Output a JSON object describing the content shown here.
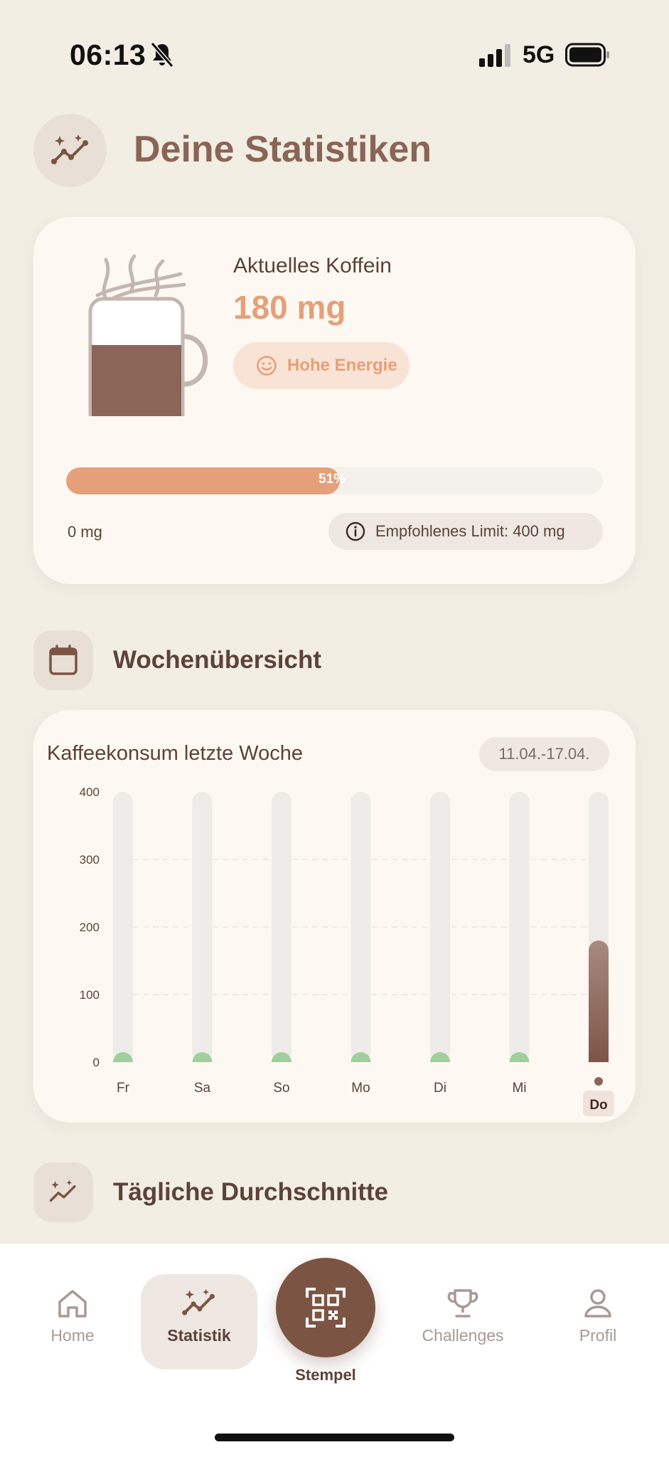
{
  "status_bar": {
    "time": "06:13",
    "network": "5G"
  },
  "header": {
    "title": "Deine Statistiken",
    "icon": "stats-sparkle-icon"
  },
  "caffeine": {
    "label": "Aktuelles Koffein",
    "value": "180 mg",
    "energy_label": "Hohe Energie",
    "energy_icon": "smile-icon",
    "progress_percent": 51,
    "progress_text": "51%",
    "min_label": "0 mg",
    "limit_label": "Empfohlenes Limit: 400 mg",
    "limit_icon": "info-icon",
    "accent_color": "#e5a07a"
  },
  "week_section": {
    "title": "Wochenübersicht",
    "icon": "calendar-icon"
  },
  "week_chart": {
    "title": "Kaffeekonsum letzte Woche",
    "date_range": "11.04.-17.04."
  },
  "chart_data": {
    "type": "bar",
    "title": "Kaffeekonsum letzte Woche",
    "categories": [
      "Fr",
      "Sa",
      "So",
      "Mo",
      "Di",
      "Mi",
      "Do"
    ],
    "values": [
      0,
      0,
      0,
      0,
      0,
      0,
      180
    ],
    "ylim": [
      0,
      400
    ],
    "yticks": [
      0,
      100,
      200,
      300,
      400
    ],
    "highlighted_category": "Do",
    "grid": true,
    "colors": {
      "bar": "#8b6558",
      "track": "#eeece8",
      "zero_marker": "#9fcf9c"
    }
  },
  "averages_section": {
    "title": "Tägliche Durchschnitte",
    "icon": "stats-sparkle-icon"
  },
  "nav": {
    "home": "Home",
    "stats": "Statistik",
    "stamp": "Stempel",
    "challenges": "Challenges",
    "profile": "Profil"
  }
}
